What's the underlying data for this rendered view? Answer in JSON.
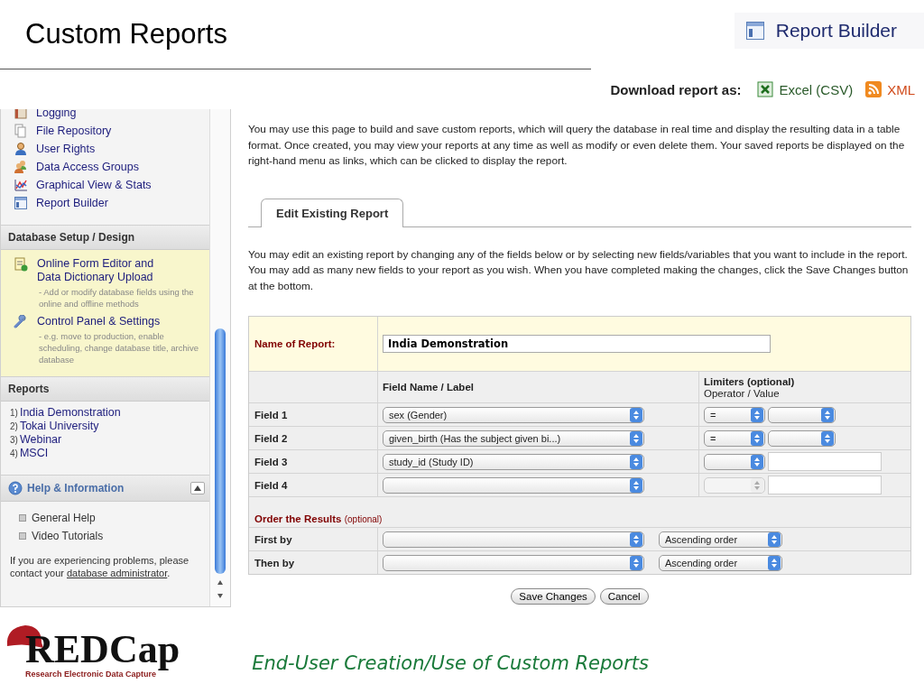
{
  "slide": {
    "title": "Custom Reports",
    "badge": {
      "label": "Report Builder"
    },
    "caption": "End-User Creation/Use of Custom Reports",
    "logo": {
      "wordmark": "REDCap",
      "tagline": "Research Electronic Data Capture"
    }
  },
  "download": {
    "label": "Download report as:",
    "links": [
      {
        "kind": "excel",
        "label": "Excel (CSV)"
      },
      {
        "kind": "rss",
        "label": "XML"
      }
    ]
  },
  "sidebar": {
    "sections": [
      {
        "kind": "links",
        "items": [
          {
            "kind": "logging",
            "label": "Logging"
          },
          {
            "kind": "files",
            "label": "File Repository"
          },
          {
            "kind": "user",
            "label": "User Rights"
          },
          {
            "kind": "group",
            "label": "Data Access Groups"
          },
          {
            "kind": "chart",
            "label": "Graphical View & Stats"
          },
          {
            "kind": "report",
            "label": "Report Builder"
          }
        ]
      },
      {
        "kind": "tools",
        "title": "Database Setup / Design",
        "items": [
          {
            "kind": "form",
            "label": "Online Form Editor and Data Dictionary Upload",
            "note": "- Add or modify database fields using the online and offline methods"
          },
          {
            "kind": "wrench",
            "label": "Control Panel & Settings",
            "note": "- e.g. move to production, enable scheduling, change database title, archive database"
          }
        ]
      },
      {
        "kind": "reports",
        "title": "Reports",
        "items": [
          {
            "number": "1)",
            "label": "India Demonstration"
          },
          {
            "number": "2)",
            "label": "Tokai University"
          },
          {
            "number": "3)",
            "label": "Webinar"
          },
          {
            "number": "4)",
            "label": "MSCI"
          }
        ]
      },
      {
        "kind": "help",
        "title": "Help & Information",
        "expanded": true,
        "items": [
          {
            "label": "General Help"
          },
          {
            "label": "Video Tutorials"
          }
        ],
        "message": "If you are experiencing problems, please contact your",
        "link": "database administrator",
        "after": "."
      }
    ]
  },
  "content": {
    "intro": "You may use this page to build and save custom reports, which will query the database in real time and display the resulting data in a table format. Once created, you may view your reports at any time as well as modify or even delete them. Your saved reports be displayed on the right-hand menu as links, which can be clicked to display the report.",
    "tabs": [
      {
        "label": "Edit Existing Report",
        "selected": true
      }
    ],
    "instructions": "You may edit an existing report by changing any of the fields below or by selecting new fields/variables that you want to include in the report. You may add as many new fields to your report as you wish. When you have completed making the changes, click the Save Changes button at the bottom.",
    "form": {
      "name_label": "Name of Report:",
      "name_value": "India Demonstration",
      "columns": {
        "field": "Field Name / Label",
        "limiters": "Limiters (optional)",
        "limiters_sub": "Operator / Value"
      },
      "fields": [
        {
          "label": "Field 1",
          "field": "sex (Gender)",
          "operator": "=",
          "operator_disabled": false,
          "value": {
            "kind": "select"
          }
        },
        {
          "label": "Field 2",
          "field": "given_birth (Has the subject given bi...)",
          "operator": "=",
          "operator_disabled": false,
          "value": {
            "kind": "select"
          }
        },
        {
          "label": "Field 3",
          "field": "study_id (Study ID)",
          "operator_disabled": false,
          "value": {
            "kind": "text"
          }
        },
        {
          "label": "Field 4",
          "operator_disabled": true,
          "value": {
            "kind": "text"
          }
        }
      ],
      "order_title": "Order the Results",
      "order_note": "(optional)",
      "order": [
        {
          "label": "First by",
          "direction": "Ascending order"
        },
        {
          "label": "Then by",
          "direction": "Ascending order"
        }
      ]
    },
    "buttons": [
      "Save Changes",
      "Cancel"
    ]
  }
}
